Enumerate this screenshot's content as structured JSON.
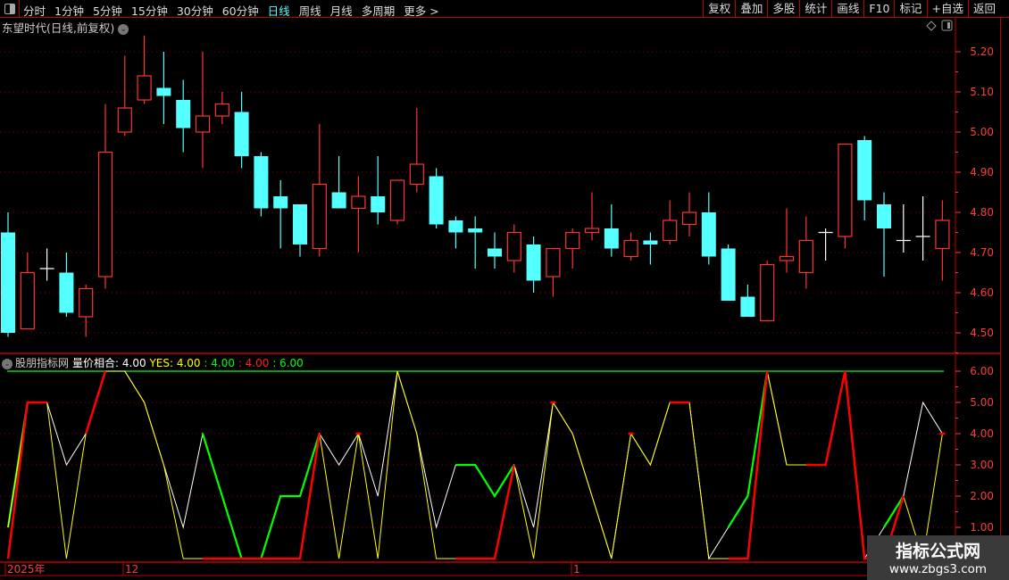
{
  "toolbar": {
    "periods": [
      "分时",
      "1分钟",
      "5分钟",
      "15分钟",
      "30分钟",
      "60分钟",
      "日线",
      "周线",
      "月线",
      "多周期",
      "更多 >"
    ],
    "active_period": "日线",
    "right_buttons": [
      "复权",
      "叠加",
      "多股",
      "统计",
      "画线",
      "F10",
      "标记",
      "+自选",
      "返回"
    ]
  },
  "chart_title": "东望时代(日线,前复权)",
  "indicator": {
    "source": "股朋指标网",
    "name": "量价相合:",
    "value": "4.00",
    "yes_label": "YES:",
    "yes_value": "4.00",
    "v2": ": 4.00",
    "v3": ": 4.00",
    "v4": ": 6.00"
  },
  "price_axis": [
    "5.20",
    "5.10",
    "5.00",
    "4.90",
    "4.80",
    "4.70",
    "4.60",
    "4.50"
  ],
  "indicator_axis": [
    "6.00",
    "5.00",
    "4.00",
    "3.00",
    "2.00",
    "1.00"
  ],
  "date_labels": [
    "2025年",
    "12",
    "1"
  ],
  "watermark": {
    "title": "指标公式网",
    "url": "www.zbgs3.com"
  },
  "colors": {
    "up": "#ff3232",
    "down": "#54ffff",
    "doji": "#ffffff",
    "axis": "#ff3c3c",
    "grid": "#8b0000",
    "yellow": "#ffff00",
    "green": "#00ff00",
    "red": "#ff0000",
    "white": "#ffffff"
  },
  "chart_data": {
    "type": "candlestick",
    "ylim": [
      4.45,
      5.25
    ],
    "ohlc": [
      [
        4.75,
        4.8,
        4.49,
        4.5
      ],
      [
        4.51,
        4.7,
        4.51,
        4.65
      ],
      [
        4.66,
        4.71,
        4.63,
        4.66
      ],
      [
        4.65,
        4.7,
        4.54,
        4.55
      ],
      [
        4.54,
        4.62,
        4.49,
        4.61
      ],
      [
        4.64,
        5.07,
        4.61,
        4.95
      ],
      [
        5.0,
        5.19,
        4.99,
        5.06
      ],
      [
        5.08,
        5.24,
        5.07,
        5.14
      ],
      [
        5.11,
        5.2,
        5.02,
        5.09
      ],
      [
        5.08,
        5.13,
        4.95,
        5.01
      ],
      [
        5.0,
        5.2,
        4.91,
        5.04
      ],
      [
        5.04,
        5.1,
        5.02,
        5.07
      ],
      [
        5.05,
        5.1,
        4.91,
        4.94
      ],
      [
        4.94,
        4.95,
        4.79,
        4.81
      ],
      [
        4.84,
        4.88,
        4.71,
        4.81
      ],
      [
        4.82,
        4.82,
        4.69,
        4.72
      ],
      [
        4.71,
        5.02,
        4.69,
        4.87
      ],
      [
        4.85,
        4.94,
        4.81,
        4.81
      ],
      [
        4.81,
        4.89,
        4.7,
        4.84
      ],
      [
        4.84,
        4.94,
        4.77,
        4.8
      ],
      [
        4.78,
        4.88,
        4.77,
        4.88
      ],
      [
        4.87,
        5.06,
        4.85,
        4.92
      ],
      [
        4.89,
        4.91,
        4.76,
        4.77
      ],
      [
        4.78,
        4.79,
        4.71,
        4.75
      ],
      [
        4.76,
        4.79,
        4.66,
        4.75
      ],
      [
        4.71,
        4.75,
        4.66,
        4.69
      ],
      [
        4.68,
        4.77,
        4.65,
        4.75
      ],
      [
        4.72,
        4.74,
        4.6,
        4.63
      ],
      [
        4.64,
        4.71,
        4.59,
        4.71
      ],
      [
        4.71,
        4.76,
        4.66,
        4.75
      ],
      [
        4.75,
        4.85,
        4.73,
        4.76
      ],
      [
        4.76,
        4.82,
        4.69,
        4.71
      ],
      [
        4.69,
        4.75,
        4.68,
        4.73
      ],
      [
        4.73,
        4.75,
        4.67,
        4.72
      ],
      [
        4.73,
        4.83,
        4.72,
        4.78
      ],
      [
        4.77,
        4.85,
        4.74,
        4.8
      ],
      [
        4.8,
        4.85,
        4.67,
        4.69
      ],
      [
        4.71,
        4.72,
        4.58,
        4.58
      ],
      [
        4.59,
        4.62,
        4.54,
        4.54
      ],
      [
        4.53,
        4.68,
        4.53,
        4.67
      ],
      [
        4.68,
        4.81,
        4.65,
        4.69
      ],
      [
        4.65,
        4.79,
        4.61,
        4.73
      ],
      [
        4.75,
        4.76,
        4.68,
        4.75
      ],
      [
        4.74,
        4.97,
        4.71,
        4.97
      ],
      [
        4.98,
        4.99,
        4.78,
        4.83
      ],
      [
        4.82,
        4.85,
        4.64,
        4.76
      ],
      [
        4.73,
        4.82,
        4.7,
        4.73
      ],
      [
        4.74,
        4.84,
        4.68,
        4.74
      ],
      [
        4.71,
        4.83,
        4.63,
        4.78
      ]
    ],
    "indicator": {
      "ylim": [
        0,
        6
      ],
      "level_line": 6,
      "white": [
        1,
        5,
        5,
        3,
        4,
        6,
        6,
        5,
        3,
        1,
        4,
        2,
        0,
        0,
        2,
        2,
        4,
        3,
        4,
        2,
        6,
        4,
        1,
        3,
        3,
        2,
        3,
        1,
        5,
        4,
        2,
        0,
        4,
        3,
        5,
        5,
        0,
        1,
        2,
        6,
        3,
        3,
        3,
        6,
        0,
        1,
        2,
        5,
        4
      ],
      "green_ranges": [
        [
          0,
          1
        ],
        [
          10,
          16
        ],
        [
          23,
          26
        ],
        [
          37,
          39
        ],
        [
          45,
          46
        ]
      ],
      "yellow": [
        1,
        5,
        5,
        0,
        4,
        6,
        6,
        5,
        3,
        0,
        0,
        0,
        0,
        0,
        0,
        0,
        4,
        0,
        4,
        0,
        6,
        4,
        0,
        0,
        0,
        0,
        3,
        0,
        5,
        4,
        2,
        0,
        4,
        3,
        5,
        5,
        0,
        0,
        0,
        6,
        3,
        3,
        3,
        6,
        0,
        0,
        2,
        0,
        4
      ],
      "red": [
        0,
        5,
        5,
        null,
        4,
        6,
        null,
        null,
        null,
        null,
        0,
        0,
        0,
        0,
        0,
        0,
        4,
        null,
        4,
        null,
        null,
        null,
        null,
        0,
        0,
        0,
        3,
        null,
        5,
        null,
        null,
        null,
        4,
        null,
        5,
        5,
        null,
        0,
        0,
        6,
        null,
        3,
        3,
        6,
        0,
        0,
        2,
        null,
        4
      ]
    }
  }
}
